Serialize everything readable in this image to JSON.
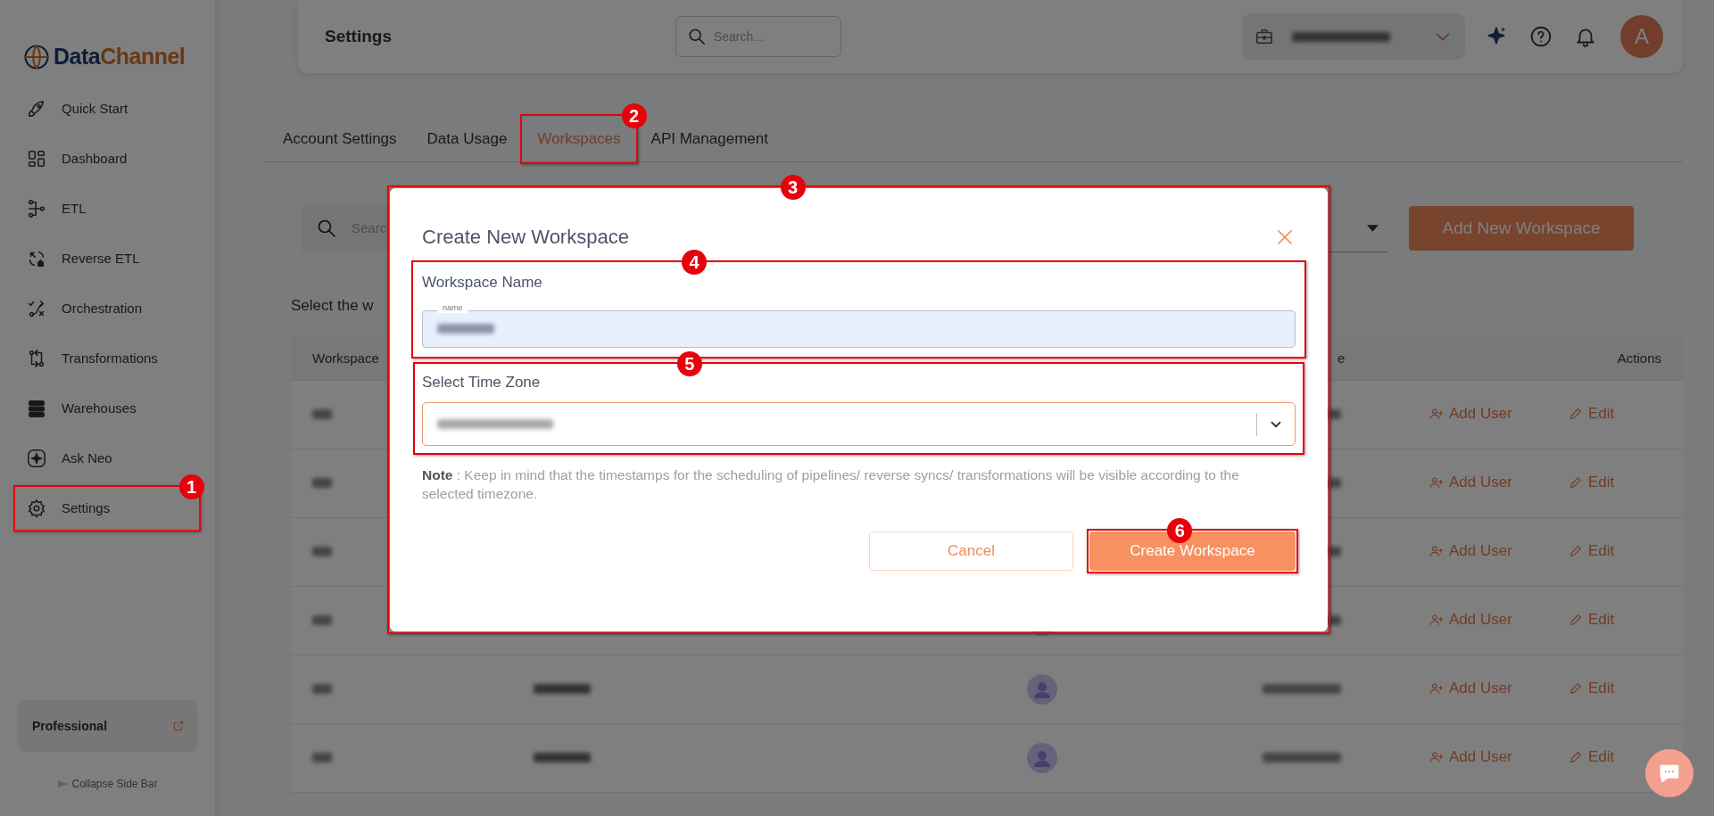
{
  "sidebar": {
    "logo": {
      "part_1": "Data",
      "part_2": "Channel"
    },
    "items": [
      {
        "label": "Quick Start"
      },
      {
        "label": "Dashboard"
      },
      {
        "label": "ETL"
      },
      {
        "label": "Reverse ETL"
      },
      {
        "label": "Orchestration"
      },
      {
        "label": "Transformations"
      },
      {
        "label": "Warehouses"
      },
      {
        "label": "Ask Neo"
      },
      {
        "label": "Settings",
        "callout": "1"
      }
    ],
    "plan": "Professional",
    "collapse": "Collapse Side Bar"
  },
  "header": {
    "title": "Settings",
    "search": {
      "placeholder": "Search..."
    },
    "avatar": "A"
  },
  "tabs": [
    {
      "label": "Account Settings",
      "selected": false
    },
    {
      "label": "Data Usage",
      "selected": false
    },
    {
      "label": "Workspaces",
      "selected": true,
      "callout": "2"
    },
    {
      "label": "API Management",
      "selected": false
    }
  ],
  "toolbar": {
    "search": {
      "placeholder": "Searc"
    },
    "add_button": "Add New Workspace"
  },
  "intro": "Select the w",
  "table": {
    "columns": [
      "Workspace",
      "e",
      "Actions"
    ],
    "rows": [
      {
        "add_user": "Add User",
        "edit": "Edit"
      },
      {
        "add_user": "Add User",
        "edit": "Edit"
      },
      {
        "add_user": "Add User",
        "edit": "Edit"
      },
      {
        "add_user": "Add User",
        "edit": "Edit"
      },
      {
        "add_user": "Add User",
        "edit": "Edit"
      },
      {
        "add_user": "Add User",
        "edit": "Edit"
      }
    ]
  },
  "modal": {
    "title": "Create New Workspace",
    "callout": "3",
    "name_field": {
      "label": "Workspace Name",
      "floating_label": "name",
      "callout": "4"
    },
    "timezone_field": {
      "label": "Select Time Zone",
      "callout": "5"
    },
    "note": "**Note** : Keep in mind that the timestamps for the scheduling of pipelines/ reverse syncs/ transformations will be visible according to the selected timezone.",
    "cancel": "Cancel",
    "create": {
      "label": "Create Workspace",
      "callout": "6"
    }
  }
}
